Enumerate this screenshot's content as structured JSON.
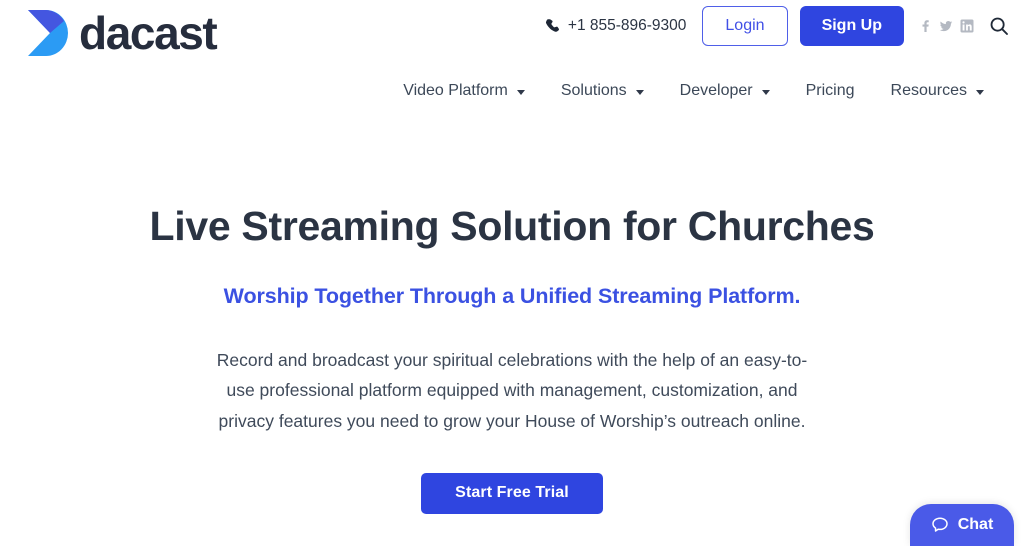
{
  "header": {
    "brand": {
      "name": "dacast",
      "logo_icon": "dacast-chevron-logo",
      "logo_colors": {
        "top": "#4456e0",
        "bottom": "#2b9bf4",
        "mid": "#3a74ea"
      }
    },
    "phone": {
      "icon": "phone-icon",
      "number": "+1 855-896-9300"
    },
    "login_label": "Login",
    "signup_label": "Sign Up",
    "social": [
      {
        "name": "facebook-icon",
        "label": "Facebook"
      },
      {
        "name": "twitter-icon",
        "label": "Twitter"
      },
      {
        "name": "linkedin-icon",
        "label": "LinkedIn"
      }
    ],
    "search_icon": "search-icon",
    "nav": [
      {
        "label": "Video Platform",
        "has_dropdown": true
      },
      {
        "label": "Solutions",
        "has_dropdown": true
      },
      {
        "label": "Developer",
        "has_dropdown": true
      },
      {
        "label": "Pricing",
        "has_dropdown": false
      },
      {
        "label": "Resources",
        "has_dropdown": true
      }
    ]
  },
  "hero": {
    "title": "Live Streaming Solution for Churches",
    "subtitle": "Worship Together Through a Unified Streaming Platform.",
    "body": "Record and broadcast your spiritual celebrations with the help of an easy-to-use professional platform equipped with management, customization, and privacy features you need to grow your House of Worship’s outreach online.",
    "cta_label": "Start Free Trial"
  },
  "chat": {
    "label": "Chat",
    "icon": "chat-bubble-icon"
  },
  "colors": {
    "accent_blue": "#2f45e0",
    "link_blue": "#3b51e2",
    "chat_blue": "#4a5ae8",
    "heading": "#2b3443",
    "body_text": "#3f4a5a",
    "social_gray": "#b4b9c2",
    "page_bg": "#ffffff"
  }
}
